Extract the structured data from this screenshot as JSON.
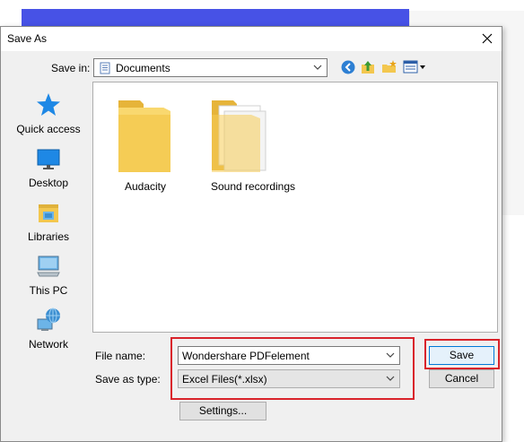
{
  "dialog": {
    "title": "Save As"
  },
  "toolbar": {
    "save_in_label": "Save in:",
    "location": "Documents",
    "icons": [
      "back-icon",
      "up-folder-icon",
      "new-folder-icon",
      "view-menu-icon"
    ]
  },
  "places": [
    {
      "label": "Quick access",
      "icon": "quick-access-star-icon"
    },
    {
      "label": "Desktop",
      "icon": "desktop-icon"
    },
    {
      "label": "Libraries",
      "icon": "libraries-icon"
    },
    {
      "label": "This PC",
      "icon": "this-pc-icon"
    },
    {
      "label": "Network",
      "icon": "network-icon"
    }
  ],
  "files": [
    {
      "name": "Audacity",
      "icon": "folder-icon"
    },
    {
      "name": "Sound recordings",
      "icon": "folder-with-files-icon"
    }
  ],
  "form": {
    "file_name_label": "File name:",
    "file_name_value": "Wondershare PDFelement",
    "save_as_type_label": "Save as type:",
    "save_as_type_value": "Excel Files(*.xlsx)"
  },
  "buttons": {
    "save": "Save",
    "cancel": "Cancel",
    "settings": "Settings..."
  },
  "colors": {
    "highlight": "#d9232b",
    "folder": "#f3c74f",
    "accent": "#0078d7",
    "background_bar": "#4752e6"
  }
}
